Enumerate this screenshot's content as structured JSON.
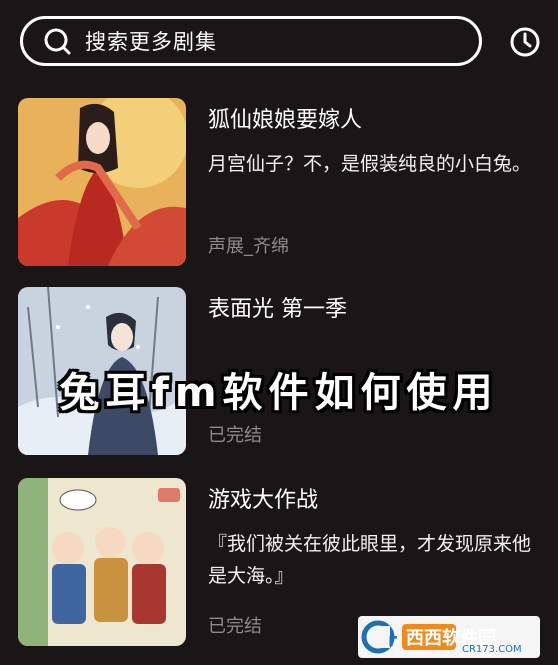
{
  "search": {
    "placeholder_text": "搜索更多剧集"
  },
  "icons": {
    "search": "search-icon",
    "history": "clock-icon"
  },
  "items": [
    {
      "title": "狐仙娘娘要嫁人",
      "description": "月宫仙子？不，是假装纯良的小白兔。",
      "meta": "声展_齐绵"
    },
    {
      "title": "表面光 第一季",
      "description": "",
      "meta": "已完结"
    },
    {
      "title": "游戏大作战",
      "description": "『我们被关在彼此眼里，才发现原来他是大海。』",
      "meta": "已完结"
    }
  ],
  "overlay": {
    "caption": "兔耳fm软件如何使用"
  },
  "watermark": {
    "brand": "西西软件园",
    "site": "CR173.COM"
  },
  "colors": {
    "background": "#1a1618",
    "meta_text": "#8f8a8c",
    "accent": "#ffffff"
  }
}
